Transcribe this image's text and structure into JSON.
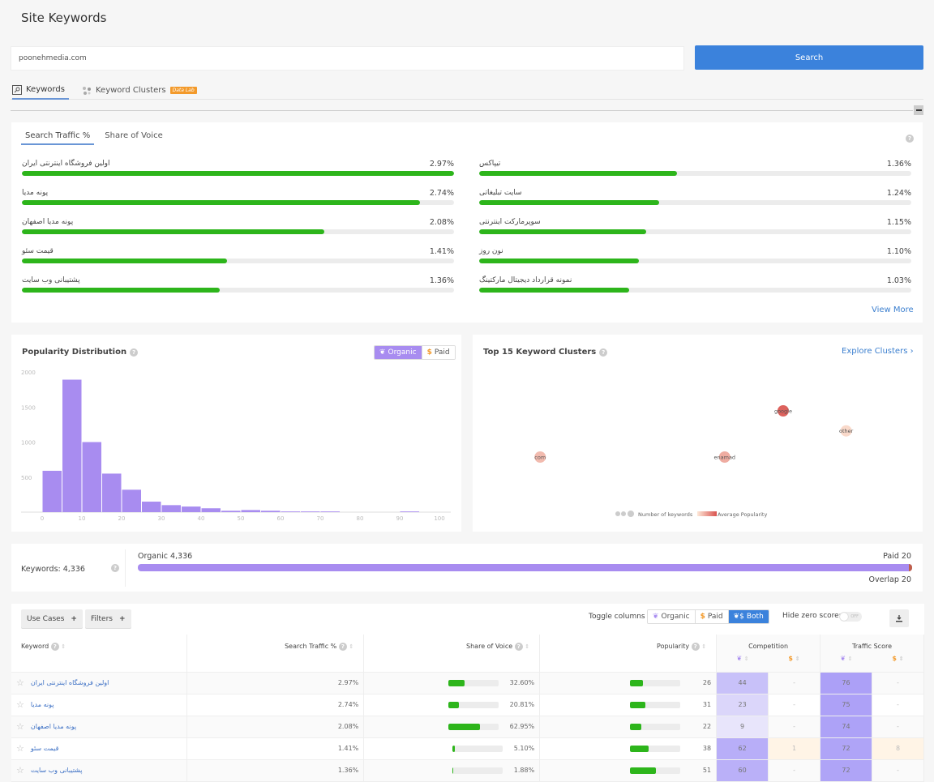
{
  "header": {
    "title": "Site Keywords"
  },
  "search": {
    "value": "poonehmedia.com",
    "button_label": "Search"
  },
  "tabs": [
    {
      "label": "Keywords",
      "icon": "keyword-search-icon",
      "active": true
    },
    {
      "label": "Keyword Clusters",
      "icon": "clusters-icon",
      "badge": "Data Lab",
      "active": false
    }
  ],
  "traffic_card": {
    "subtabs": [
      {
        "label": "Search Traffic %",
        "active": true
      },
      {
        "label": "Share of Voice",
        "active": false
      }
    ],
    "view_more": "View More",
    "left": [
      {
        "keyword": "اولین فروشگاه اینترنتی ایران",
        "value": "2.97%",
        "fraction": 1.0
      },
      {
        "keyword": "پونه مدیا",
        "value": "2.74%",
        "fraction": 0.922
      },
      {
        "keyword": "پونه مدیا اصفهان",
        "value": "2.08%",
        "fraction": 0.7
      },
      {
        "keyword": "قیمت سئو",
        "value": "1.41%",
        "fraction": 0.475
      },
      {
        "keyword": "پشتیبانی وب سایت",
        "value": "1.36%",
        "fraction": 0.458
      }
    ],
    "right": [
      {
        "keyword": "تیپاکس",
        "value": "1.36%",
        "fraction": 0.458
      },
      {
        "keyword": "سایت تبلیغاتی",
        "value": "1.24%",
        "fraction": 0.417
      },
      {
        "keyword": "سوپرمارکت اینترنتی",
        "value": "1.15%",
        "fraction": 0.387
      },
      {
        "keyword": "نون روز",
        "value": "1.10%",
        "fraction": 0.37
      },
      {
        "keyword": "نمونه قرارداد دیجیتال مارکتینگ",
        "value": "1.03%",
        "fraction": 0.347
      }
    ]
  },
  "popularity": {
    "title": "Popularity Distribution",
    "toggle": [
      {
        "label": "Organic",
        "active": true
      },
      {
        "label": "Paid",
        "active": false
      }
    ]
  },
  "chart_data": {
    "type": "bar",
    "title": "Popularity Distribution",
    "xlabel": "",
    "ylabel": "",
    "bins": [
      0,
      5,
      10,
      15,
      20,
      25,
      30,
      35,
      40,
      45,
      50,
      55,
      60,
      65,
      70,
      75,
      80,
      85,
      90,
      95
    ],
    "values": [
      590,
      1890,
      1000,
      550,
      320,
      150,
      100,
      80,
      55,
      20,
      30,
      20,
      10,
      10,
      10,
      0,
      0,
      0,
      10,
      0
    ],
    "xticks": [
      "0",
      "10",
      "20",
      "30",
      "40",
      "50",
      "60",
      "70",
      "80",
      "90",
      "100"
    ],
    "yticks": [
      "500",
      "1000",
      "1500",
      "2000"
    ],
    "xlim": [
      0,
      100
    ],
    "ylim": [
      0,
      2000
    ],
    "color": "#a88cf0"
  },
  "clusters": {
    "title": "Top 15 Keyword Clusters",
    "explore_label": "Explore Clusters",
    "bubbles": [
      {
        "label": "google",
        "x": 0.69,
        "y": 0.3,
        "popularity": 0.9
      },
      {
        "label": "other",
        "x": 0.83,
        "y": 0.43,
        "popularity": 0.1
      },
      {
        "label": "com",
        "x": 0.15,
        "y": 0.6,
        "popularity": 0.3
      },
      {
        "label": "enamad",
        "x": 0.56,
        "y": 0.6,
        "popularity": 0.4
      }
    ],
    "legend_size": "Number of keywords",
    "legend_color": "Average Popularity"
  },
  "overview": {
    "keywords_label": "Keywords: 4,336",
    "organic_label": "Organic 4,336",
    "paid_label": "Paid 20",
    "overlap_label": "Overlap 20",
    "paid_fraction": 0.0046
  },
  "table_toolbar": {
    "use_cases": "Use Cases",
    "filters": "Filters",
    "toggle_columns_label": "Toggle columns",
    "toggle_options": [
      {
        "label": "Organic"
      },
      {
        "label": "Paid"
      },
      {
        "label": "Both",
        "active": true
      }
    ],
    "hide_zero_label": "Hide zero scores",
    "hide_zero_state": "OFF"
  },
  "table": {
    "columns": {
      "keyword": "Keyword",
      "search_traffic": "Search Traffic %",
      "share_of_voice": "Share of Voice",
      "popularity": "Popularity",
      "competition": "Competition",
      "traffic_score": "Traffic Score"
    },
    "rows": [
      {
        "keyword": "اولین فروشگاه اینترنتی ایران",
        "traffic": "2.97%",
        "sov": "32.60%",
        "sov_f": 0.326,
        "pop": "26",
        "pop_f": 0.26,
        "comp_o": "44",
        "comp_p": "-",
        "ts_o": "76",
        "ts_p": "-"
      },
      {
        "keyword": "پونه مدیا",
        "traffic": "2.74%",
        "sov": "20.81%",
        "sov_f": 0.208,
        "pop": "31",
        "pop_f": 0.31,
        "comp_o": "23",
        "comp_p": "-",
        "ts_o": "75",
        "ts_p": "-"
      },
      {
        "keyword": "پونه مدیا اصفهان",
        "traffic": "2.08%",
        "sov": "62.95%",
        "sov_f": 0.63,
        "pop": "22",
        "pop_f": 0.22,
        "comp_o": "9",
        "comp_p": "-",
        "ts_o": "74",
        "ts_p": "-"
      },
      {
        "keyword": "قیمت سئو",
        "traffic": "1.41%",
        "sov": "5.10%",
        "sov_f": 0.051,
        "pop": "38",
        "pop_f": 0.38,
        "comp_o": "62",
        "comp_p": "1",
        "ts_o": "72",
        "ts_p": "8"
      },
      {
        "keyword": "پشتیبانی وب سایت",
        "traffic": "1.36%",
        "sov": "1.88%",
        "sov_f": 0.019,
        "pop": "51",
        "pop_f": 0.51,
        "comp_o": "60",
        "comp_p": "-",
        "ts_o": "72",
        "ts_p": "-"
      }
    ]
  }
}
